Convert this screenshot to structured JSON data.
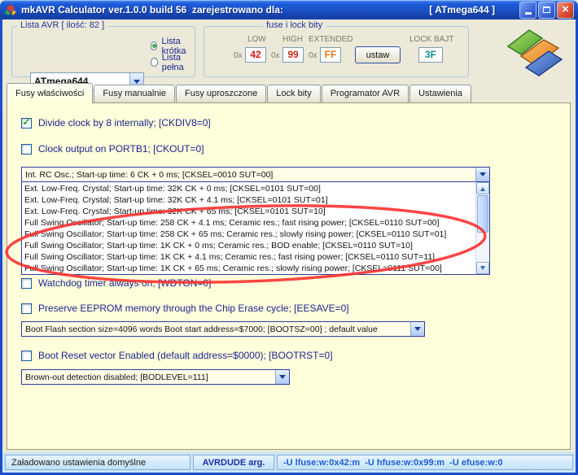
{
  "titlebar": {
    "title": "mkAVR Calculator ver.1.0.0 build 56  zarejestrowano dla:",
    "device": "[ ATmega644 ]"
  },
  "avr_list": {
    "caption": "Lista AVR [ ilość: 82 ]",
    "selected": "ATmega644",
    "radio_short": "Lista krótka",
    "radio_full": "Lista pełna"
  },
  "fuse_box": {
    "caption": "fuse i lock bity",
    "low_label": "LOW",
    "high_label": "HIGH",
    "extended_label": "EXTENDED",
    "lock_label": "LOCK BAJT",
    "hex_prefix": "0x",
    "low": "42",
    "high": "99",
    "extended": "FF",
    "lock": "3F",
    "set_button": "ustaw"
  },
  "tabs": [
    {
      "label": "Fusy właściwości",
      "active": true
    },
    {
      "label": "Fusy manualnie",
      "active": false
    },
    {
      "label": "Fusy uproszczone",
      "active": false
    },
    {
      "label": "Lock bity",
      "active": false
    },
    {
      "label": "Programator AVR",
      "active": false
    },
    {
      "label": "Ustawienia",
      "active": false
    }
  ],
  "fuses": {
    "ckdiv8": {
      "label": "Divide clock by 8 internally; [CKDIV8=0]",
      "checked": true
    },
    "ckout": {
      "label": "Clock output on PORTB1; [CKOUT=0]",
      "checked": false
    },
    "clock_selected": "Int. RC Osc.; Start-up time: 6 CK + 0 ms; [CKSEL=0010 SUT=00]",
    "clock_options": [
      "Ext. Low-Freq. Crystal; Start-up time: 32K CK + 0 ms; [CKSEL=0101 SUT=00]",
      "Ext. Low-Freq. Crystal; Start-up time: 32K CK + 4.1 ms; [CKSEL=0101 SUT=01]",
      "Ext. Low-Freq. Crystal; Start-up time: 32K CK + 65 ms; [CKSEL=0101 SUT=10]",
      "Full Swing Oscillator; Start-up time: 258 CK + 4.1 ms; Ceramic res.; fast rising power; [CKSEL=0110 SUT=00]",
      "Full Swing Oscillator; Start-up time: 258 CK + 65 ms; Ceramic res.; slowly rising power; [CKSEL=0110 SUT=01]",
      "Full Swing Oscillator; Start-up time: 1K CK + 0 ms; Ceramic res.; BOD enable; [CKSEL=0110 SUT=10]",
      "Full Swing Oscillator; Start-up time: 1K CK + 4.1 ms; Ceramic res.; fast rising power; [CKSEL=0110 SUT=11]",
      "Full Swing Oscillator; Start-up time: 1K CK + 65 ms; Ceramic res.; slowly rising power; [CKSEL=0111 SUT=00]"
    ],
    "wdton": {
      "label": "Watchdog timer always on; [WDTON=0]",
      "checked": false
    },
    "eesave": {
      "label": "Preserve EEPROM memory through the Chip Erase cycle; [EESAVE=0]",
      "checked": false
    },
    "bootsz_selected": "Boot Flash section size=4096 words Boot start address=$7000; [BOOTSZ=00] ; default value",
    "bootrst": {
      "label": "Boot Reset vector Enabled (default address=$0000); [BOOTRST=0]",
      "checked": false
    },
    "bod_selected": "Brown-out detection disabled; [BODLEVEL=111]"
  },
  "statusbar": {
    "message": "Załadowano ustawienia domyślne",
    "avrdude_label": "AVRDUDE arg.",
    "avrdude_args": "-U lfuse:w:0x42:m  -U hfuse:w:0x99:m  -U efuse:w:0"
  },
  "colors": {
    "fuse_low": "#E01010",
    "fuse_high": "#C02818",
    "fuse_extended": "#E07818",
    "lock_byte": "#128C8C",
    "annotation": "#FC2C2C",
    "titlebar": "#1A4FC5",
    "panel_bg": "#FFFFDB"
  }
}
